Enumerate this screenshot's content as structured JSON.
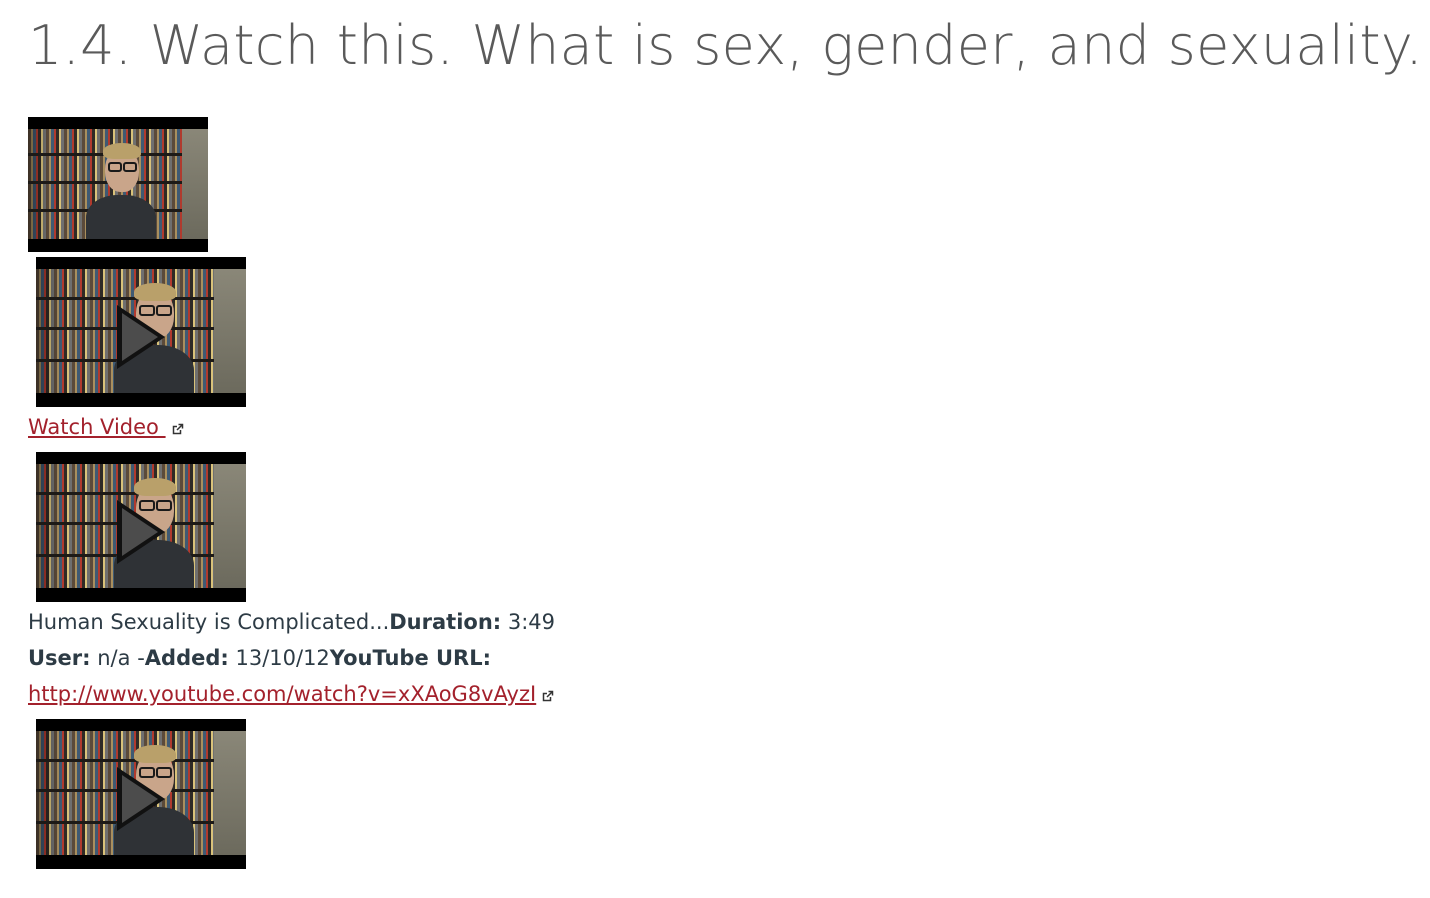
{
  "page": {
    "title": "1.4. Watch this. What is sex, gender, and sexuality."
  },
  "video": {
    "watch_link_label": "Watch Video ",
    "description": "Human Sexuality is Complicated...",
    "duration_label": "Duration:",
    "duration_value": "3:49",
    "user_label": "User:",
    "user_value": "n/a",
    "separator": "-",
    "added_label": "Added:",
    "added_value": "13/10/12",
    "youtube_url_label": "YouTube URL:",
    "youtube_url": "http://www.youtube.com/watch?v=xXAoG8vAyzI"
  },
  "icons": {
    "external_link": "external-link-icon",
    "play": "play-icon"
  },
  "colors": {
    "link": "#a3212c",
    "title": "#5a5a5a",
    "text": "#2d3b45"
  }
}
